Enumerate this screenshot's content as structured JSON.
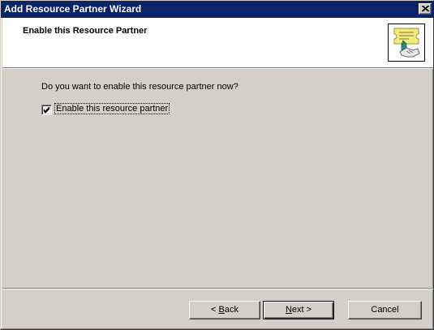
{
  "window": {
    "title": "Add Resource Partner Wizard"
  },
  "header": {
    "title": "Enable this Resource Partner",
    "icon": "wizard-handshake-certificate-icon"
  },
  "content": {
    "question": "Do you want to enable this resource partner now?",
    "checkbox": {
      "label": "Enable this resource partner",
      "checked": true
    }
  },
  "buttons": {
    "back": {
      "prefix": "< ",
      "mnemonic": "B",
      "rest": "ack"
    },
    "next": {
      "mnemonic": "N",
      "rest": "ext >"
    },
    "cancel": "Cancel"
  },
  "colors": {
    "titlebar": "#0a246a",
    "face": "#d4d0c8"
  }
}
